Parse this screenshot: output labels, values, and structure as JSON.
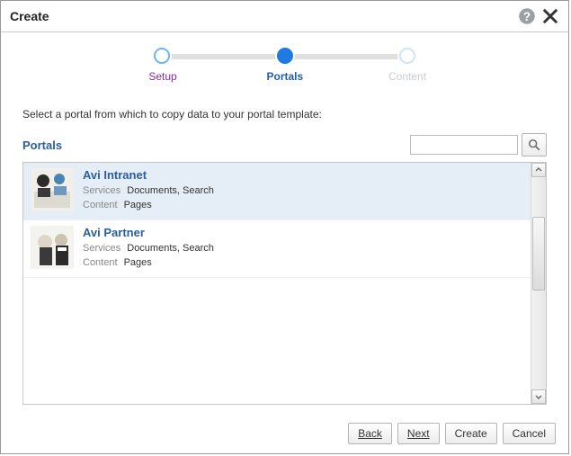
{
  "dialog": {
    "title": "Create"
  },
  "stepper": {
    "steps": [
      {
        "label": "Setup",
        "state": "done"
      },
      {
        "label": "Portals",
        "state": "current"
      },
      {
        "label": "Content",
        "state": "future"
      }
    ]
  },
  "instruction": "Select a portal from which to copy data to your portal template:",
  "section": {
    "title": "Portals"
  },
  "search": {
    "value": "",
    "placeholder": ""
  },
  "labels": {
    "services": "Services",
    "content": "Content"
  },
  "portals": [
    {
      "name": "Avi Intranet",
      "services": "Documents, Search",
      "content": "Pages",
      "selected": true
    },
    {
      "name": "Avi Partner",
      "services": "Documents, Search",
      "content": "Pages",
      "selected": false
    }
  ],
  "footer": {
    "back": "Back",
    "next": "Next",
    "create": "Create",
    "cancel": "Cancel"
  }
}
